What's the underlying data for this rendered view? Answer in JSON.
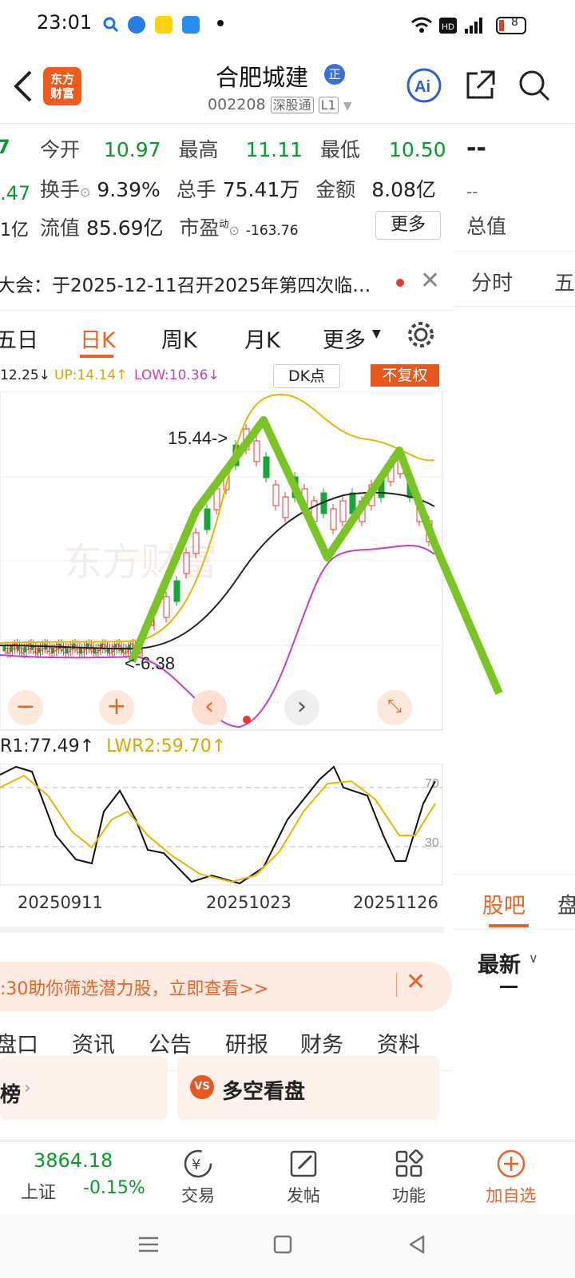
{
  "status": {
    "time": "23:01",
    "battery": "8"
  },
  "header": {
    "logo_line1": "东方",
    "logo_line2": "财富",
    "title": "合肥城建",
    "badge": "正",
    "code": "002208",
    "market": "深股通",
    "level": "L1"
  },
  "quote": {
    "left_top": "7",
    "left_mid": ".47",
    "left_bot": "1亿",
    "open_label": "今开",
    "open": "10.97",
    "high_label": "最高",
    "high": "11.11",
    "low_label": "最低",
    "low": "10.50",
    "turnover_label": "换手",
    "turnover": "9.39%",
    "volume_label": "总手",
    "volume": "75.41万",
    "amount_label": "金额",
    "amount": "8.08亿",
    "float_label": "流值",
    "float_value": "85.69亿",
    "pe_label": "市盈",
    "pe_sup": "动",
    "pe": "-163.76",
    "more": "更多"
  },
  "right_panel": {
    "dash": "--",
    "dash2": "--",
    "total_label": "总值",
    "fenshi": "分时",
    "wu": "五",
    "guba": "股吧",
    "pan": "盘",
    "latest": "最新"
  },
  "notice": {
    "text": "大会：于2025-12-11召开2025年第四次临…"
  },
  "tabs": [
    "五日",
    "日K",
    "周K",
    "月K",
    "更多"
  ],
  "chart_header": {
    "mid": "12.25",
    "up": "UP:14.14",
    "low": "LOW:10.36",
    "dk": "DK点",
    "fq": "不复权"
  },
  "chart_data": {
    "type": "candlestick",
    "annotations": {
      "high": "15.44->",
      "low": "<-6.38"
    },
    "indicator": {
      "lwr1": "R1:77.49",
      "lwr2": "LWR2:59.70",
      "level_high": "70",
      "level_low": "30"
    },
    "x_labels": [
      "20250911",
      "20251023",
      "20251126"
    ]
  },
  "banner": {
    "text": ":30助你筛选潜力股，立即查看>>"
  },
  "subtabs": [
    "盘口",
    "资讯",
    "公告",
    "研报",
    "财务",
    "资料"
  ],
  "cards": {
    "left": "榜",
    "right": "多空看盘",
    "vs": "VS"
  },
  "bottom": {
    "index_value": "3864.18",
    "index_name": "上证",
    "index_change": "-0.15%",
    "trade": "交易",
    "post": "发帖",
    "func": "功能",
    "add": "加自选"
  }
}
